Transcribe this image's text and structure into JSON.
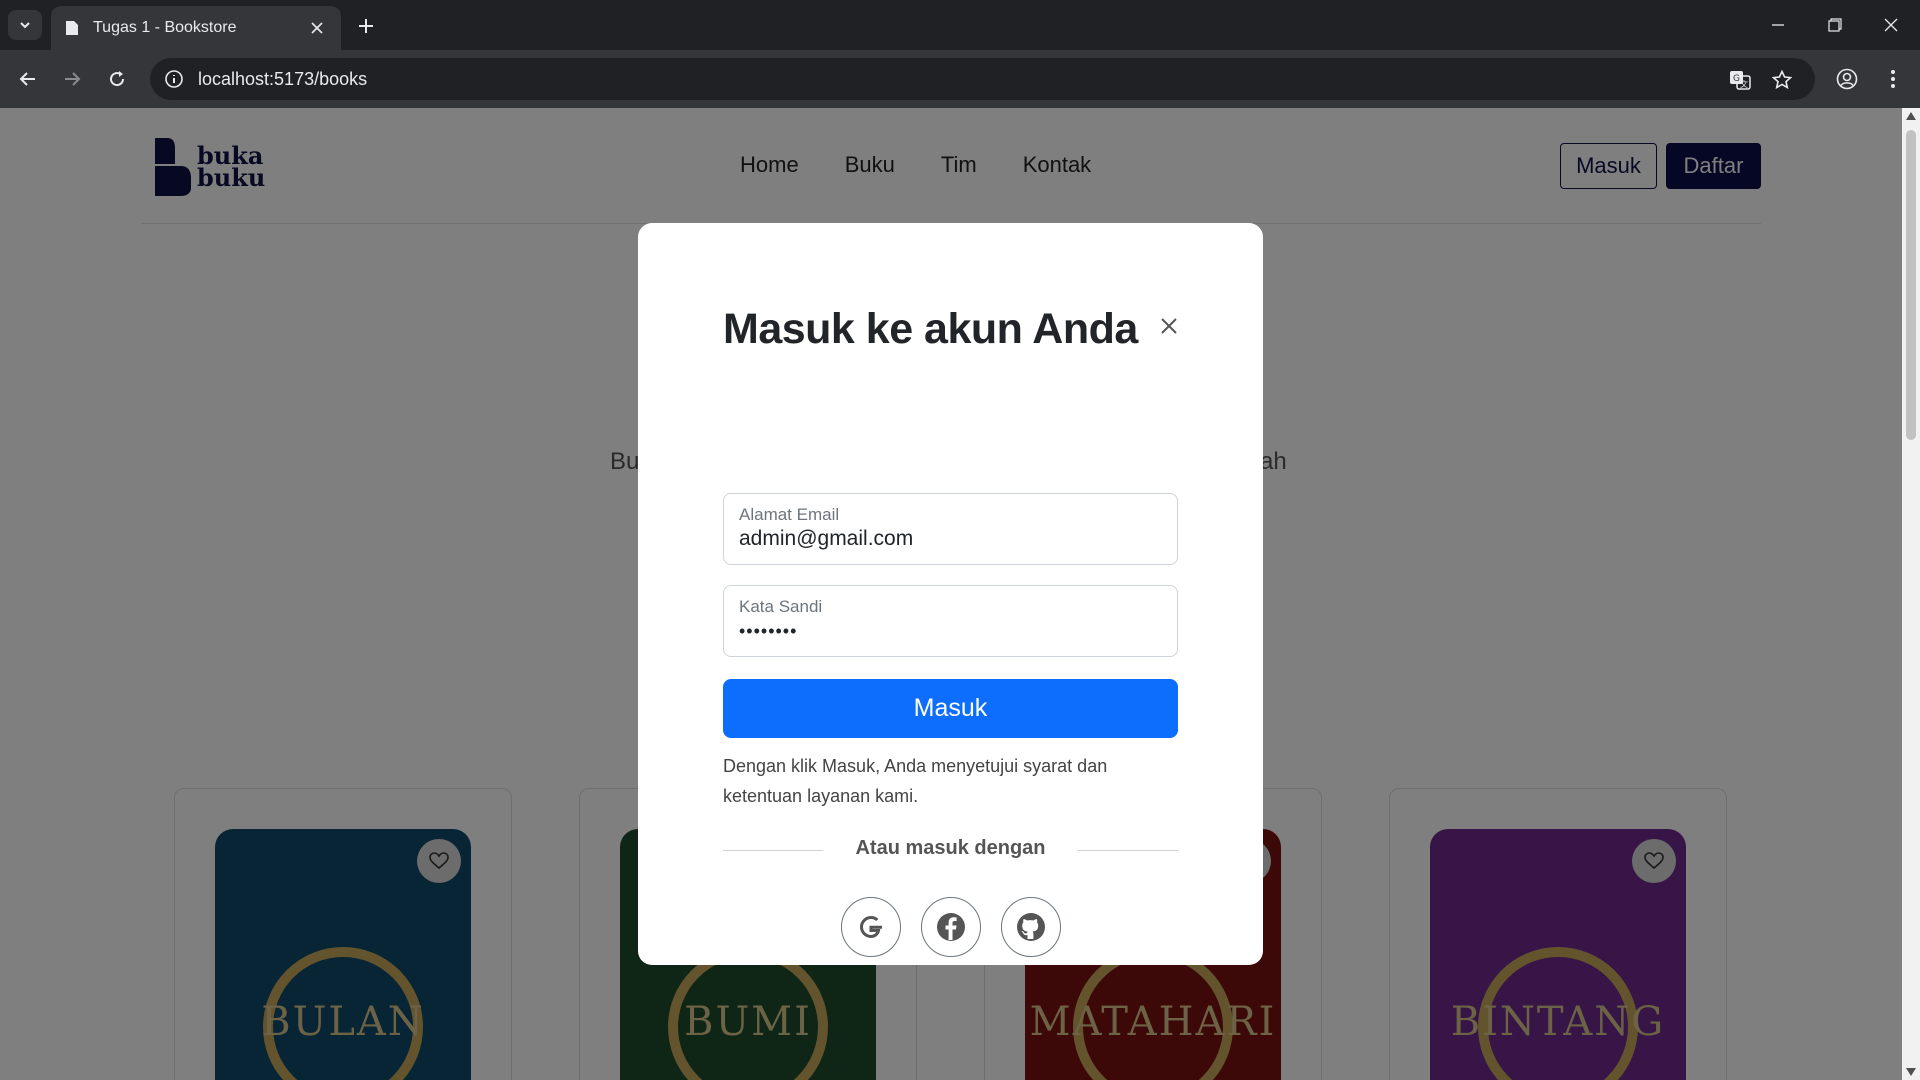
{
  "browser": {
    "tab_title": "Tugas 1 - Bookstore",
    "url": "localhost:5173/books"
  },
  "header": {
    "logo_line1": "buka",
    "logo_line2": "buku",
    "nav": [
      "Home",
      "Buku",
      "Tim",
      "Kontak"
    ],
    "login_label": "Masuk",
    "register_label": "Daftar"
  },
  "hero": {
    "subtitle_left": "Bu",
    "subtitle_right": "ah"
  },
  "books": [
    {
      "title": "BULAN",
      "color": "#0f4a6a"
    },
    {
      "title": "BUMI",
      "color": "#1f4d2e"
    },
    {
      "title": "MATAHARI",
      "color": "#7a1010"
    },
    {
      "title": "BINTANG",
      "color": "#6e2a8c"
    }
  ],
  "modal": {
    "title": "Masuk ke akun Anda",
    "email_label": "Alamat Email",
    "email_value": "admin@gmail.com",
    "password_label": "Kata Sandi",
    "password_value": "••••••••",
    "submit_label": "Masuk",
    "terms": "Dengan klik Masuk, Anda menyetujui syarat dan ketentuan layanan kami.",
    "divider_text": "Atau masuk dengan",
    "social": [
      "google-icon",
      "facebook-icon",
      "github-icon"
    ]
  },
  "colors": {
    "primary": "#0d6efd",
    "brand_navy": "#0b0e4a"
  }
}
